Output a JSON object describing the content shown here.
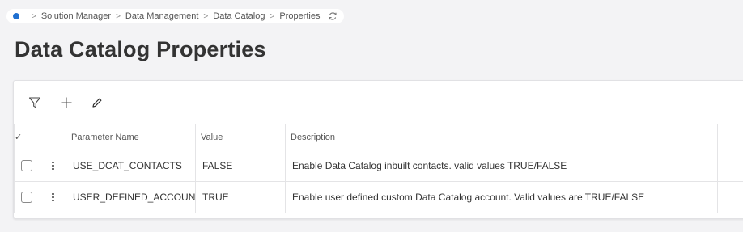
{
  "breadcrumb": {
    "items": [
      "Solution Manager",
      "Data Management",
      "Data Catalog",
      "Properties"
    ],
    "separator": ">",
    "home_icon": "home-dot-icon",
    "refresh_icon": "refresh-icon",
    "accent": "#1f6fd0"
  },
  "page": {
    "title": "Data Catalog Properties"
  },
  "toolbar": {
    "icons": [
      "filter-icon",
      "plus-icon",
      "pencil-icon"
    ]
  },
  "table": {
    "header_check": "✓",
    "columns": {
      "name": "Parameter Name",
      "value": "Value",
      "description": "Description"
    },
    "rows": [
      {
        "name": "USE_DCAT_CONTACTS",
        "value": "FALSE",
        "description": "Enable Data Catalog inbuilt contacts. valid values TRUE/FALSE"
      },
      {
        "name": "USER_DEFINED_ACCOUNT",
        "value": "TRUE",
        "description": "Enable user defined custom Data Catalog account. Valid values are TRUE/FALSE"
      }
    ]
  }
}
